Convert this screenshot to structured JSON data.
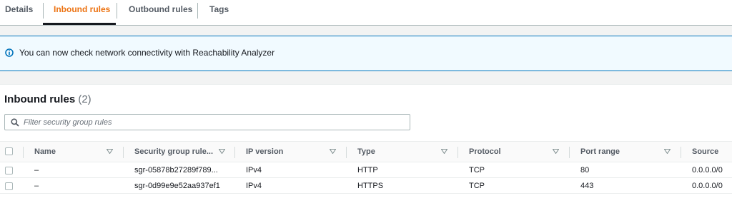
{
  "tabs": [
    {
      "label": "Details"
    },
    {
      "label": "Inbound rules",
      "active": true
    },
    {
      "label": "Outbound rules"
    },
    {
      "label": "Tags"
    }
  ],
  "banner": {
    "text": "You can now check network connectivity with Reachability Analyzer",
    "icon": "info-icon"
  },
  "panel": {
    "title": "Inbound rules",
    "count": "(2)"
  },
  "filter": {
    "placeholder": "Filter security group rules",
    "value": ""
  },
  "table": {
    "columns": [
      "Name",
      "Security group rule...",
      "IP version",
      "Type",
      "Protocol",
      "Port range",
      "Source"
    ],
    "rows": [
      [
        "–",
        "sgr-05878b27289f789...",
        "IPv4",
        "HTTP",
        "TCP",
        "80",
        "0.0.0.0/0"
      ],
      [
        "–",
        "sgr-0d99e9e52aa937ef1",
        "IPv4",
        "HTTPS",
        "TCP",
        "443",
        "0.0.0.0/0"
      ]
    ]
  },
  "colors": {
    "accent": "#ec7211",
    "info": "#0073bb",
    "banner_bg": "#f1faff"
  }
}
